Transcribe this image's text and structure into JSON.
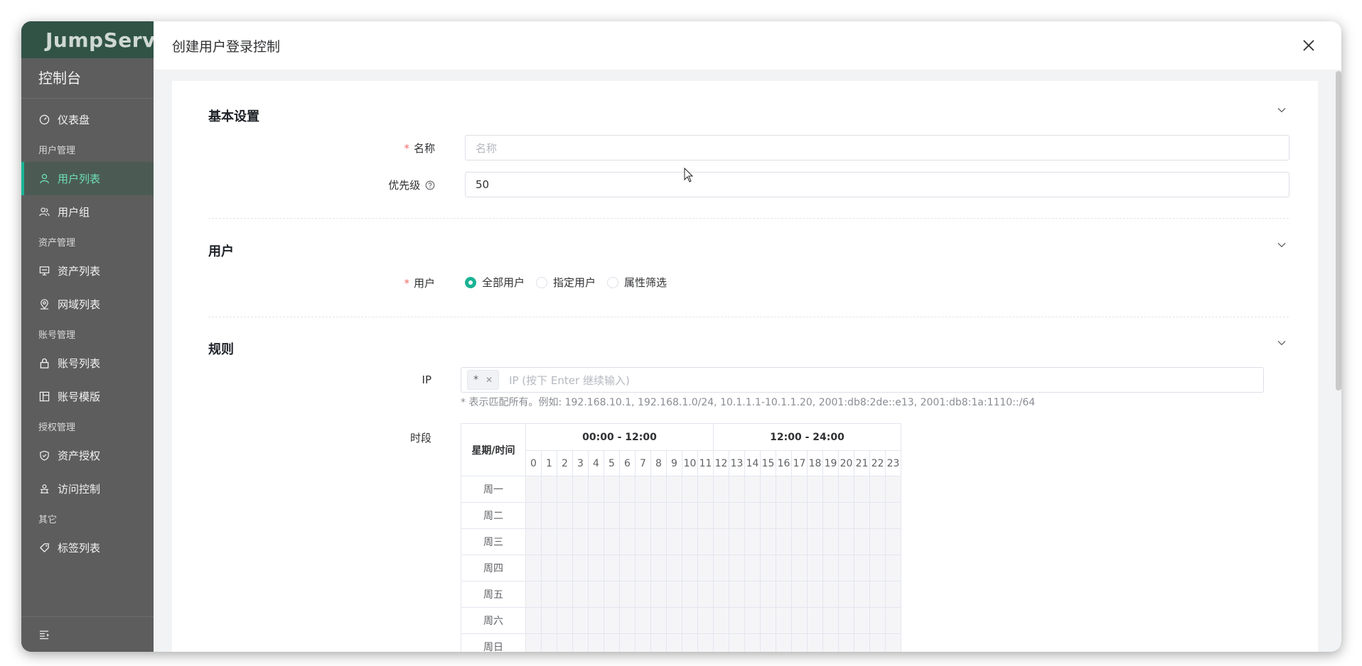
{
  "sidebar": {
    "logo_text": "JumpServ",
    "console": "控制台",
    "groups": {
      "dashboard": "仪表盘",
      "user_mgmt": "用户管理",
      "user_list": "用户列表",
      "user_group": "用户组",
      "asset_mgmt": "资产管理",
      "asset_list": "资产列表",
      "domain_list": "网域列表",
      "account_mgmt": "账号管理",
      "account_list": "账号列表",
      "account_template": "账号模版",
      "perm_mgmt": "授权管理",
      "asset_perm": "资产授权",
      "access_control": "访问控制",
      "other": "其它",
      "tag_list": "标签列表"
    },
    "accent_color": "#1ab394"
  },
  "drawer": {
    "title": "创建用户登录控制"
  },
  "sections": {
    "basic": {
      "title": "基本设置",
      "name_label": "名称",
      "name_placeholder": "名称",
      "priority_label": "优先级",
      "priority_value": "50"
    },
    "user": {
      "title": "用户",
      "user_label": "用户",
      "options": [
        "全部用户",
        "指定用户",
        "属性筛选"
      ],
      "selected": "全部用户"
    },
    "rules": {
      "title": "规则",
      "ip_label": "IP",
      "ip_tag": "*",
      "ip_placeholder": "IP (按下 Enter 继续输入)",
      "ip_hint": "* 表示匹配所有。例如: 192.168.10.1, 192.168.1.0/24, 10.1.1.1-10.1.1.20, 2001:db8:2de::e13, 2001:db8:1a:1110::/64",
      "period_label": "时段",
      "table": {
        "corner": "星期/时间",
        "am": "00:00 - 12:00",
        "pm": "12:00 - 24:00",
        "hours": [
          "0",
          "1",
          "2",
          "3",
          "4",
          "5",
          "6",
          "7",
          "8",
          "9",
          "10",
          "11",
          "12",
          "13",
          "14",
          "15",
          "16",
          "17",
          "18",
          "19",
          "20",
          "21",
          "22",
          "23"
        ],
        "days": [
          "周一",
          "周二",
          "周三",
          "周四",
          "周五",
          "周六",
          "周日"
        ]
      }
    }
  }
}
